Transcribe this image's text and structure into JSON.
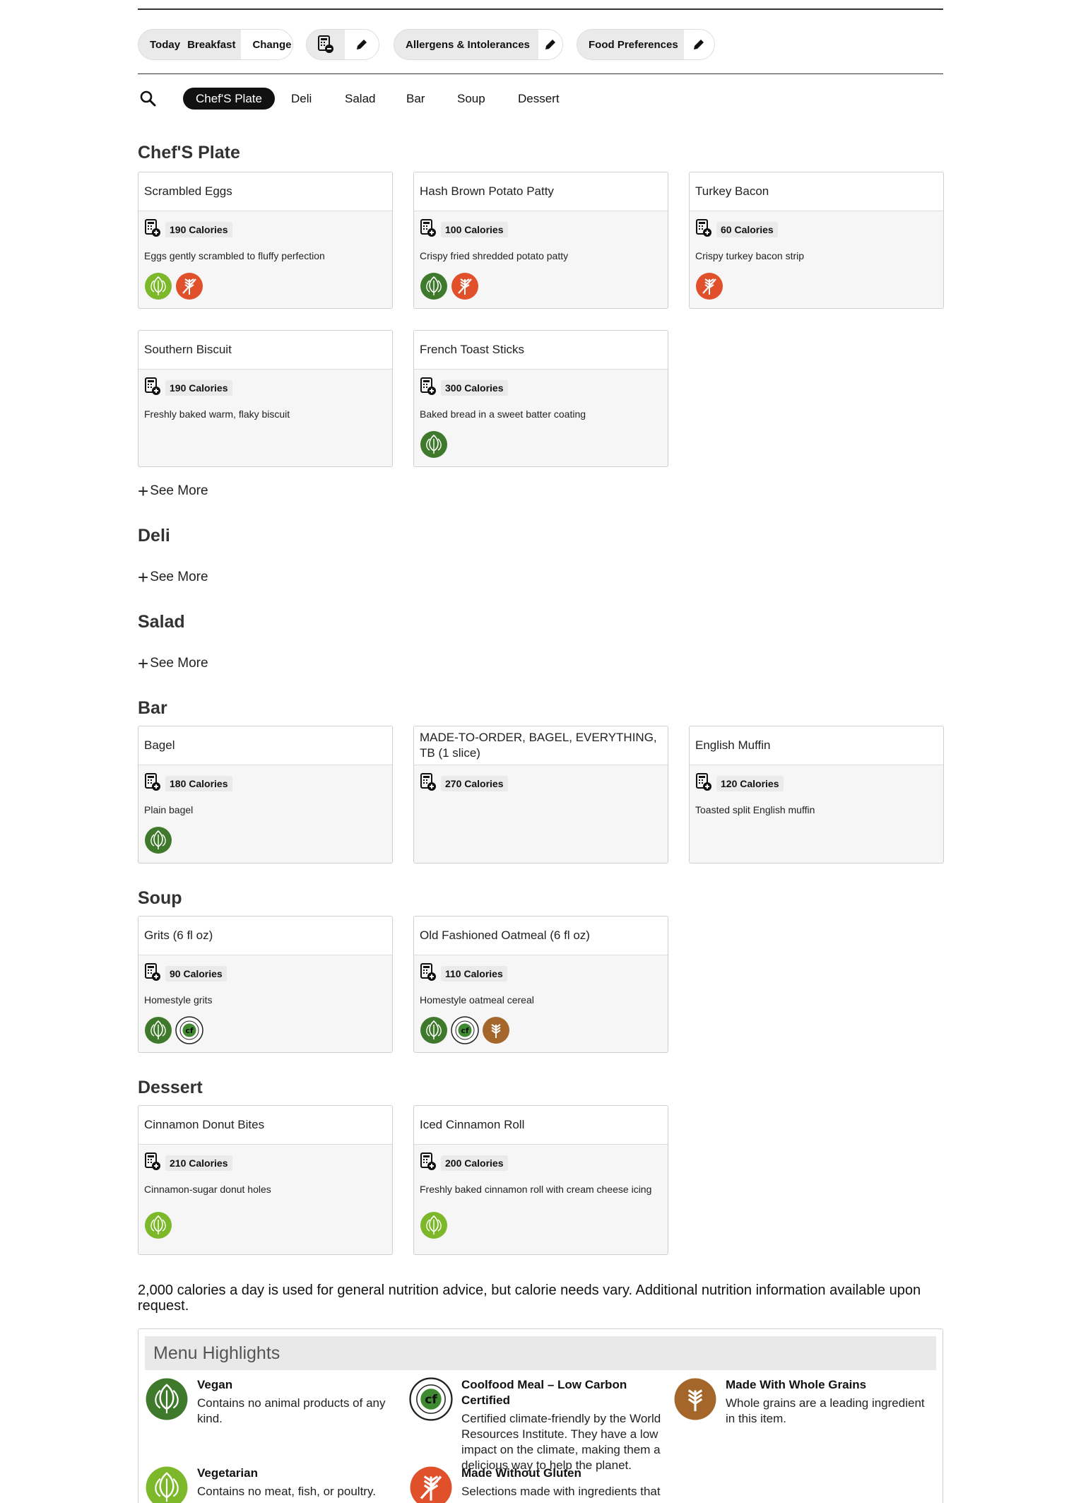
{
  "toolbar": {
    "day_label": "Today",
    "meal_label": "Breakfast",
    "change_label": "Change",
    "allergens_label": "Allergens & Intolerances",
    "preferences_label": "Food Preferences"
  },
  "tabs": [
    "Chef'S Plate",
    "Deli",
    "Salad",
    "Bar",
    "Soup",
    "Dessert"
  ],
  "active_tab": "Chef'S Plate",
  "see_more_label": "See More",
  "sections": {
    "chefs_plate": {
      "title": "Chef'S Plate",
      "items": [
        {
          "name": "Scrambled Eggs",
          "calories": "190 Calories",
          "desc": "Eggs gently scrambled to fluffy perfection",
          "badges": [
            "vegetarian-icon",
            "made-without-gluten-icon"
          ]
        },
        {
          "name": "Hash Brown Potato Patty",
          "calories": "100 Calories",
          "desc": "Crispy fried shredded potato patty",
          "badges": [
            "vegan-icon",
            "made-without-gluten-icon"
          ]
        },
        {
          "name": "Turkey Bacon",
          "calories": "60 Calories",
          "desc": "Crispy turkey bacon strip",
          "badges": [
            "made-without-gluten-icon"
          ]
        },
        {
          "name": "Southern Biscuit",
          "calories": "190 Calories",
          "desc": "Freshly baked warm, flaky biscuit",
          "badges": []
        },
        {
          "name": "French Toast Sticks",
          "calories": "300 Calories",
          "desc": "Baked bread in a sweet batter coating",
          "badges": [
            "vegan-icon"
          ]
        }
      ]
    },
    "deli": {
      "title": "Deli"
    },
    "salad": {
      "title": "Salad"
    },
    "bar": {
      "title": "Bar",
      "items": [
        {
          "name": "Bagel",
          "calories": "180 Calories",
          "desc": "Plain bagel",
          "badges": [
            "vegan-icon"
          ]
        },
        {
          "name": "MADE-TO-ORDER, BAGEL, EVERYTHING, TB (1 slice)",
          "calories": "270 Calories",
          "desc": "",
          "badges": []
        },
        {
          "name": "English Muffin",
          "calories": "120 Calories",
          "desc": "Toasted split English muffin",
          "badges": []
        }
      ]
    },
    "soup": {
      "title": "Soup",
      "items": [
        {
          "name": "Grits (6 fl oz)",
          "calories": "90 Calories",
          "desc": "Homestyle grits",
          "badges": [
            "vegan-icon",
            "low-carbon-icon"
          ]
        },
        {
          "name": "Old Fashioned Oatmeal (6 fl oz)",
          "calories": "110 Calories",
          "desc": "Homestyle oatmeal cereal",
          "badges": [
            "vegan-icon",
            "low-carbon-icon",
            "whole-grains-icon"
          ]
        }
      ]
    },
    "dessert": {
      "title": "Dessert",
      "items": [
        {
          "name": "Cinnamon Donut Bites",
          "calories": "210 Calories",
          "desc": "Cinnamon-sugar donut holes",
          "badges": [
            "vegetarian-icon"
          ]
        },
        {
          "name": "Iced Cinnamon Roll",
          "calories": "200 Calories",
          "desc": "Freshly baked cinnamon roll with cream cheese icing",
          "badges": [
            "vegetarian-icon"
          ]
        }
      ]
    }
  },
  "footer_note": "2,000 calories a day is used for general nutrition advice, but calorie needs vary. Additional nutrition information available upon request.",
  "highlights": {
    "title": "Menu Highlights",
    "items": [
      {
        "title": "Vegan",
        "desc": "Contains no animal products of any kind.",
        "icon": "vegan-icon"
      },
      {
        "title": "Coolfood Meal – Low Carbon Certified",
        "desc": "Certified climate-friendly by the World Resources Institute. They have a low impact on the climate, making them a delicious way to help the planet.",
        "icon": "low-carbon-icon"
      },
      {
        "title": "Made With Whole Grains",
        "desc": "Whole grains are a leading ingredient in this item.",
        "icon": "whole-grains-icon"
      },
      {
        "title": "Vegetarian",
        "desc": "Contains no meat, fish, or poultry.",
        "icon": "vegetarian-icon"
      },
      {
        "title": "Made Without Gluten",
        "desc": "Selections made with ingredients that",
        "icon": "made-without-gluten-icon"
      }
    ]
  },
  "colors": {
    "vegan": "#3f7a2c",
    "vegetarian": "#7cb82a",
    "gluten_free": "#e0502a",
    "whole_grains": "#a4662a",
    "low_carbon": "#ffffff",
    "active_tab": "#111111"
  }
}
